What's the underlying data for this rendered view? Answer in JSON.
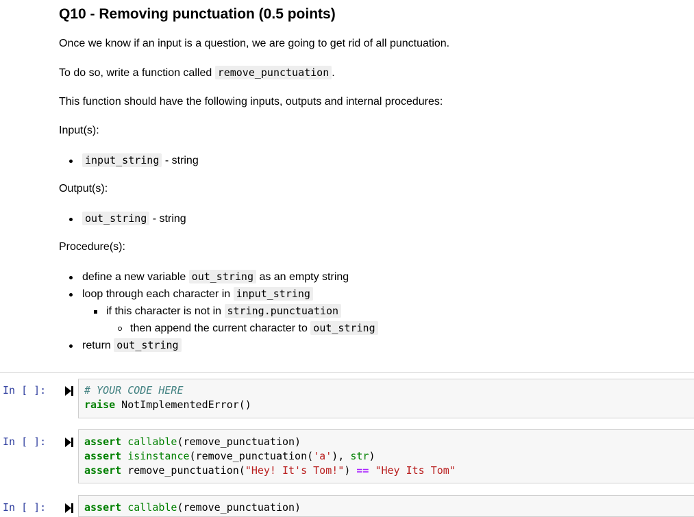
{
  "markdown": {
    "title": "Q10 - Removing punctuation (0.5 points)",
    "intro": "Once we know if an input is a question, we are going to get rid of all punctuation.",
    "todo_prefix": "To do so, write a function called",
    "todo_code": "remove_punctuation",
    "todo_suffix": ".",
    "procedures_intro": "This function should have the following inputs, outputs and internal procedures:",
    "inputs_heading": "Input(s):",
    "input_code": "input_string",
    "input_desc": "- string",
    "outputs_heading": "Output(s):",
    "output_code": "out_string",
    "output_desc": "- string",
    "procedure_heading": "Procedure(s):",
    "proc1_prefix": "define a new variable",
    "proc1_code": "out_string",
    "proc1_suffix": "as an empty string",
    "proc2_prefix": "loop through each character in",
    "proc2_code": "input_string",
    "proc3_prefix": "if this character is not in",
    "proc3_code": "string.punctuation",
    "proc4_prefix": "then append the current character to",
    "proc4_code": "out_string",
    "proc5_prefix": "return",
    "proc5_code": "out_string"
  },
  "cells": [
    {
      "prompt": "In [ ]:",
      "lines": [
        "# YOUR CODE HERE",
        "raise NotImplementedError()"
      ]
    },
    {
      "prompt": "In [ ]:",
      "lines": [
        "assert callable(remove_punctuation)",
        "assert isinstance(remove_punctuation('a'), str)",
        "assert remove_punctuation(\"Hey! It's Tom!\") == \"Hey Its Tom\""
      ]
    },
    {
      "prompt": "In [ ]:",
      "lines": [
        "assert callable(remove_punctuation)"
      ]
    }
  ],
  "colors": {
    "prompt": "#303f9f",
    "keyword": "#008000",
    "string": "#ba2121",
    "comment": "#408080",
    "operator": "#aa22ff"
  },
  "icons": {
    "run": "run-cell-icon"
  }
}
